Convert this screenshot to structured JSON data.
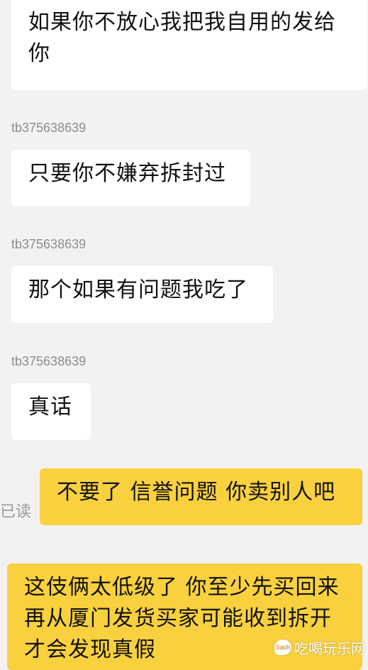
{
  "messages": [
    {
      "text": "如果你不放心我把我自用的发给你"
    },
    {
      "sender": "tb375638639",
      "text": "只要你不嫌弃拆封过"
    },
    {
      "sender": "tb375638639",
      "text": "那个如果有问题我吃了"
    },
    {
      "sender": "tb375638639",
      "text": "真话"
    },
    {
      "status": "已读",
      "text": "不要了 信誉问题 你卖别人吧"
    },
    {
      "text": "这伎俩太低级了 你至少先买回来再从厦门发货买家可能收到拆开才会发现真假"
    }
  ],
  "watermark": {
    "logo": "Sach",
    "text": "吃喝玩乐网"
  },
  "colors": {
    "background": "#f2f2f2",
    "incoming": "#ffffff",
    "outgoing": "#f9d13e"
  }
}
